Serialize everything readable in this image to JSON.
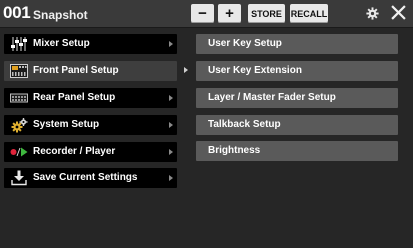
{
  "header": {
    "snapshot_number": "001",
    "snapshot_label": "Snapshot",
    "minus_label": "−",
    "plus_label": "+",
    "store_label": "STORE",
    "recall_label": "RECALL"
  },
  "menu": {
    "items": [
      {
        "label": "Mixer Setup",
        "icon": "mixer-faders-icon"
      },
      {
        "label": "Front Panel Setup",
        "icon": "front-panel-icon",
        "selected": true
      },
      {
        "label": "Rear Panel Setup",
        "icon": "rear-panel-icon"
      },
      {
        "label": "System Setup",
        "icon": "gears-icon"
      },
      {
        "label": "Recorder / Player",
        "icon": "record-play-icon"
      },
      {
        "label": "Save Current Settings",
        "icon": "download-save-icon"
      }
    ]
  },
  "submenu": {
    "items": [
      {
        "label": "User Key Setup"
      },
      {
        "label": "User Key Extension"
      },
      {
        "label": "Layer / Master Fader Setup"
      },
      {
        "label": "Talkback Setup"
      },
      {
        "label": "Brightness"
      }
    ]
  },
  "colors": {
    "background": "#262626",
    "header": "#3a3a3a",
    "menu_item": "#000000",
    "menu_selected": "#3e3e3e",
    "submenu_item": "#5a5a5a",
    "record_red": "#e0233a",
    "play_green": "#3fb83f"
  }
}
